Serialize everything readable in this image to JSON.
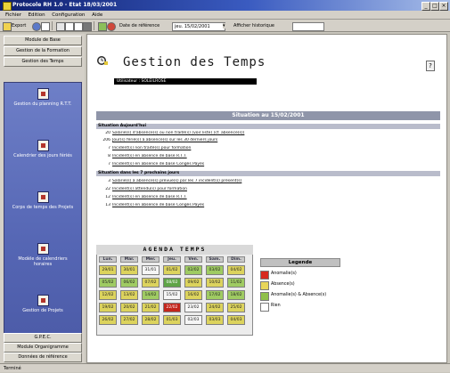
{
  "window": {
    "title": "Protocole RH 1.0 - Etat 18/03/2001"
  },
  "menu": [
    "Fichier",
    "Edition",
    "Configuration",
    "Aide"
  ],
  "toolbar": {
    "export_label": "Export",
    "date_label": "Date de référence",
    "date_value": "jeu. 15/02/2001",
    "action_label": "Afficher historique",
    "input_value": ""
  },
  "sidebar": {
    "top_buttons": [
      "Module de Base",
      "Gestion de la Formation",
      "Gestion des Temps"
    ],
    "nav_items": [
      "Gestion du planning R.T.T.",
      "Calendrier des jours fériés",
      "Corps de temps des Projets",
      "Modèle de calendriers horaires",
      "Gestion de Projets"
    ],
    "bottom_buttons": [
      "G.P.E.C.",
      "Module Organigramme",
      "Données de référence"
    ]
  },
  "main": {
    "heading": "Gestion des Temps",
    "user_info": "Utilisateur : SOLEILROSE",
    "help_label": "?",
    "situation_title": "Situation au 15/02/2001",
    "sections": [
      {
        "label": "Situation Aujourd'hui",
        "lines": [
          {
            "n": "20",
            "text": "Salarié(s) d'absence(s) ou non traité(s) (voir liste) (cf. absence(s))"
          },
          {
            "n": "206",
            "text": "Jour(s) férié(s) à absence(s) sur les 30 derniers jours"
          },
          {
            "n": "7",
            "text": "Incident(s) non traité(s) pour formation"
          },
          {
            "n": "8",
            "text": "Incident(s) en absence de base R.T.T."
          },
          {
            "n": "7",
            "text": "Incident(s) en absence de base Congés Payés"
          }
        ]
      },
      {
        "label": "Situation dans les 7 prochains jours",
        "lines": [
          {
            "n": "3",
            "text": "Salarié(s) à absence(s) prévue(s) par les 7 incident(s) présent(s)"
          },
          {
            "n": "22",
            "text": "Incident(s) attendu(s) pour formation"
          },
          {
            "n": "12",
            "text": "Incident(s) en absence de base R.T.T."
          },
          {
            "n": "13",
            "text": "Incident(s) en absence de base Congés Payés"
          }
        ]
      }
    ]
  },
  "agenda": {
    "title": "AGENDA TEMPS",
    "days": [
      "Lun.",
      "Mar.",
      "Mer.",
      "Jeu.",
      "Ven.",
      "Sam.",
      "Dim."
    ],
    "weeks": [
      [
        {
          "d": "29/01",
          "s": "y"
        },
        {
          "d": "30/01",
          "s": "y"
        },
        {
          "d": "31/01",
          "s": "w"
        },
        {
          "d": "01/02",
          "s": "y"
        },
        {
          "d": "02/02",
          "s": "g"
        },
        {
          "d": "03/02",
          "s": "g"
        },
        {
          "d": "04/02",
          "s": "y"
        }
      ],
      [
        {
          "d": "05/02",
          "s": "g"
        },
        {
          "d": "06/02",
          "s": "g"
        },
        {
          "d": "07/02",
          "s": "y"
        },
        {
          "d": "08/02",
          "s": "dg"
        },
        {
          "d": "09/02",
          "s": "y"
        },
        {
          "d": "10/02",
          "s": "y"
        },
        {
          "d": "11/02",
          "s": "g"
        }
      ],
      [
        {
          "d": "12/02",
          "s": "y"
        },
        {
          "d": "13/02",
          "s": "y"
        },
        {
          "d": "14/02",
          "s": "g"
        },
        {
          "d": "15/02",
          "s": "w"
        },
        {
          "d": "16/02",
          "s": "y"
        },
        {
          "d": "17/02",
          "s": "g"
        },
        {
          "d": "18/02",
          "s": "g"
        }
      ],
      [
        {
          "d": "19/02",
          "s": "y"
        },
        {
          "d": "20/02",
          "s": "y"
        },
        {
          "d": "21/02",
          "s": "y"
        },
        {
          "d": "22/02",
          "s": "r"
        },
        {
          "d": "23/02",
          "s": "w"
        },
        {
          "d": "24/02",
          "s": "y"
        },
        {
          "d": "25/02",
          "s": "y"
        }
      ],
      [
        {
          "d": "26/02",
          "s": "y"
        },
        {
          "d": "27/02",
          "s": "y"
        },
        {
          "d": "28/02",
          "s": "y"
        },
        {
          "d": "01/03",
          "s": "y"
        },
        {
          "d": "02/03",
          "s": "w"
        },
        {
          "d": "03/03",
          "s": "y"
        },
        {
          "d": "04/03",
          "s": "y"
        }
      ]
    ]
  },
  "legend": {
    "title": "Legende",
    "items": [
      {
        "label": "Anomalie(s)",
        "color": "#d7291f"
      },
      {
        "label": "Absence(s)",
        "color": "#e8d65a"
      },
      {
        "label": "Anomalie(s) & Absence(s)",
        "color": "#8fc04b"
      },
      {
        "label": "Rien",
        "color": "#ffffff"
      }
    ]
  },
  "colors": {
    "y": "#dcd35d",
    "g": "#9fcb62",
    "dg": "#5fa446",
    "r": "#c3261b",
    "w": "#f6f6f6"
  },
  "statusbar": "Terminé"
}
